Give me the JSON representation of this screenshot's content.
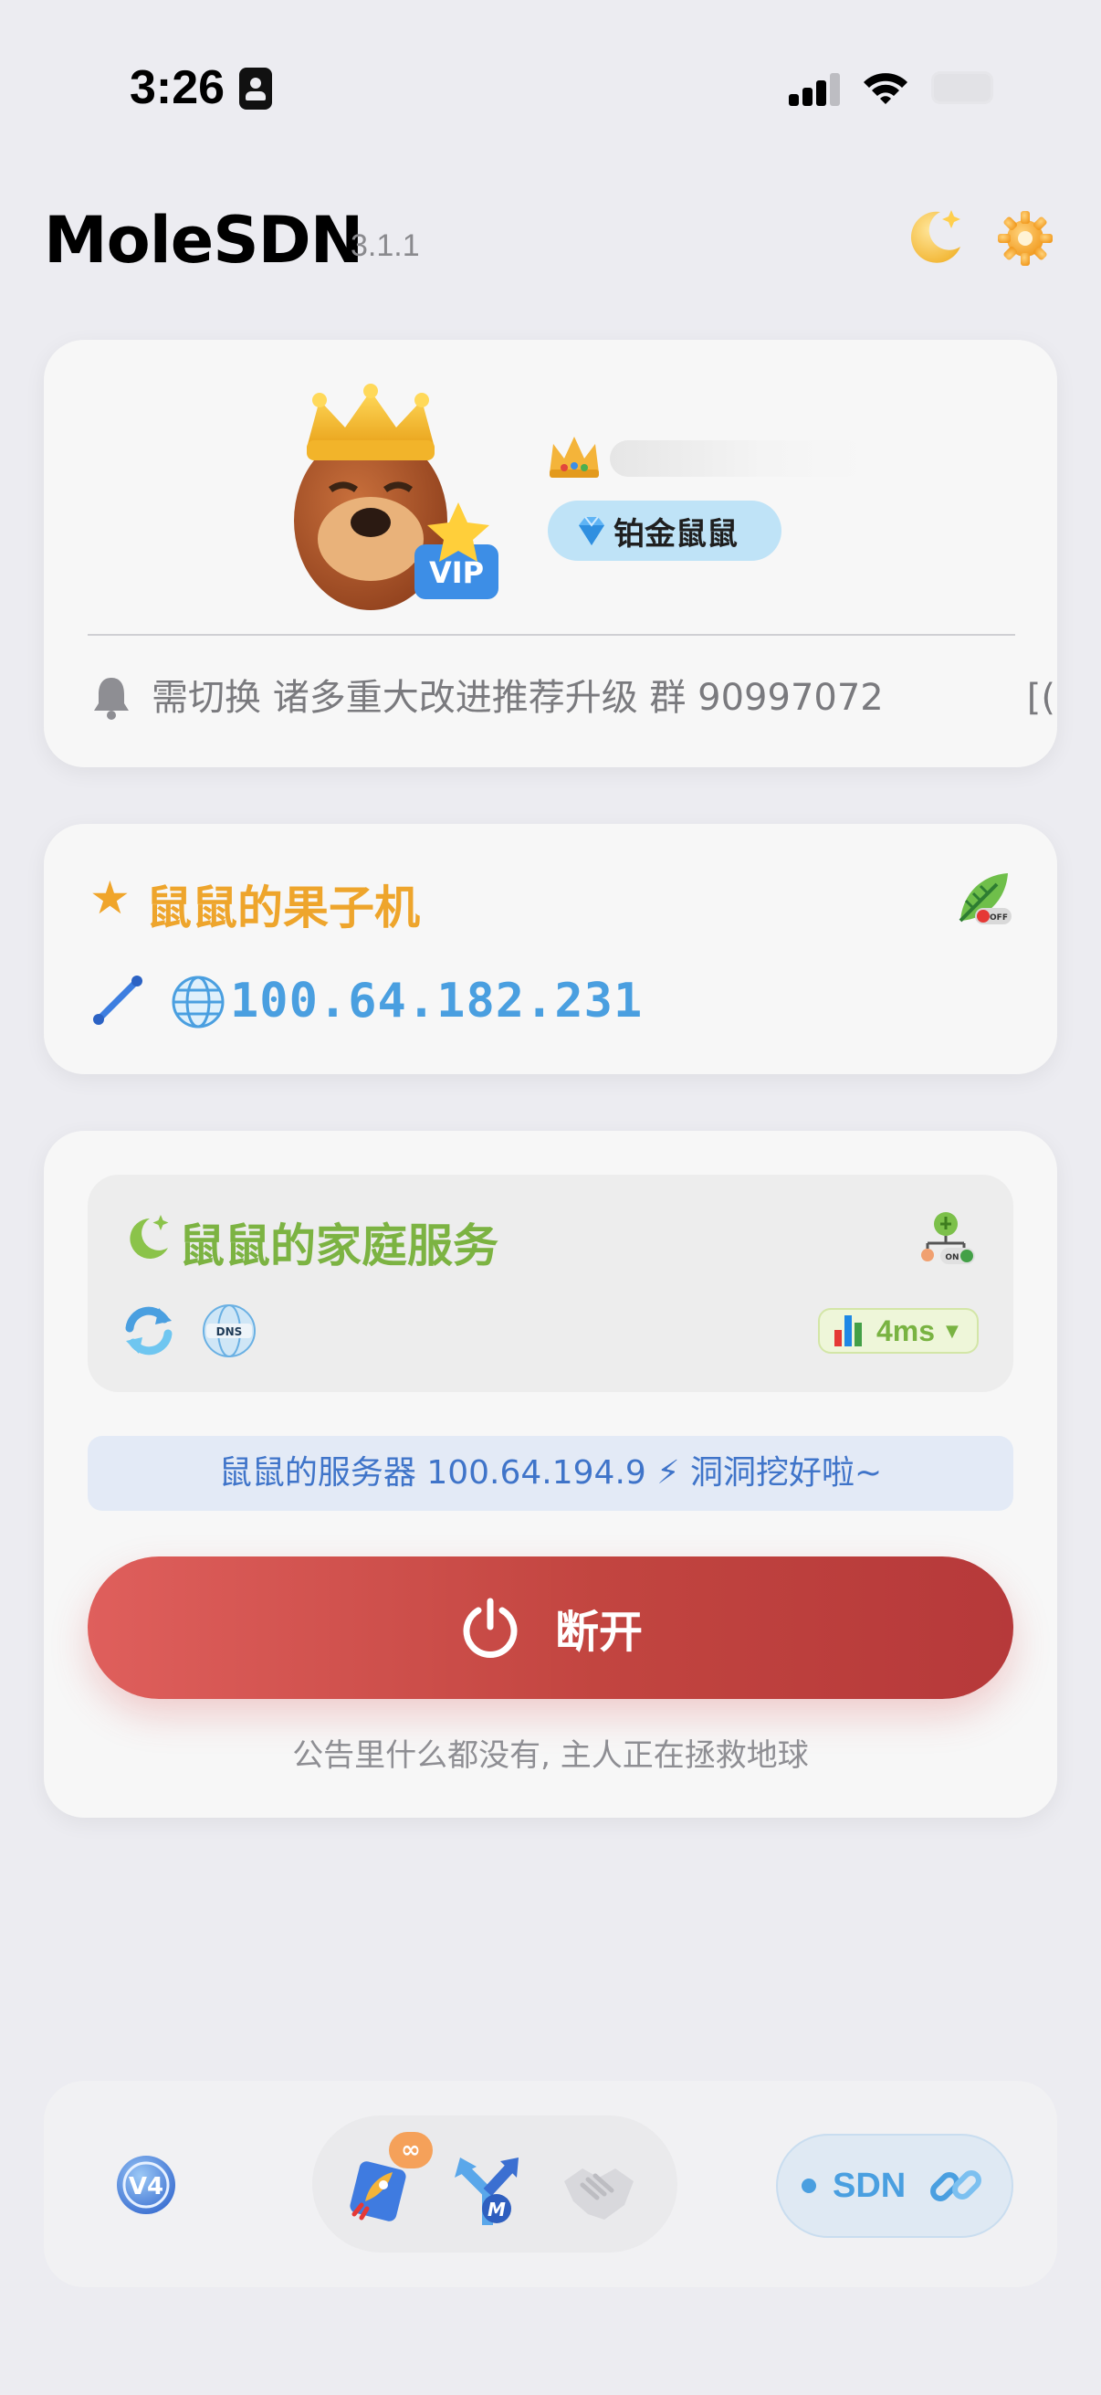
{
  "status_bar": {
    "time": "3:26"
  },
  "header": {
    "title": "MoleSDN",
    "version": "3.1.1"
  },
  "profile": {
    "tier": "铂金鼠鼠",
    "notice": "需切换 诸多重大改进推荐升级 群 90997072",
    "notice_tail": "[("
  },
  "device": {
    "name": "鼠鼠的果子机",
    "ip": "100.64.182.231"
  },
  "service": {
    "name": "鼠鼠的家庭服务",
    "ping": "4ms",
    "server_status": "鼠鼠的服务器 100.64.194.9 ⚡ 洞洞挖好啦~",
    "disconnect_label": "断开",
    "footnote": "公告里什么都没有, 主人正在拯救地球"
  },
  "nav": {
    "infinity_badge": "∞",
    "sdn_label": "SDN"
  },
  "colors": {
    "background": "#ececf1",
    "device_name": "#eea52c",
    "service_name": "#7cb342",
    "ip_text": "#4a9fe0",
    "disconnect": "#c9484a",
    "banner_text": "#3f74c9"
  }
}
